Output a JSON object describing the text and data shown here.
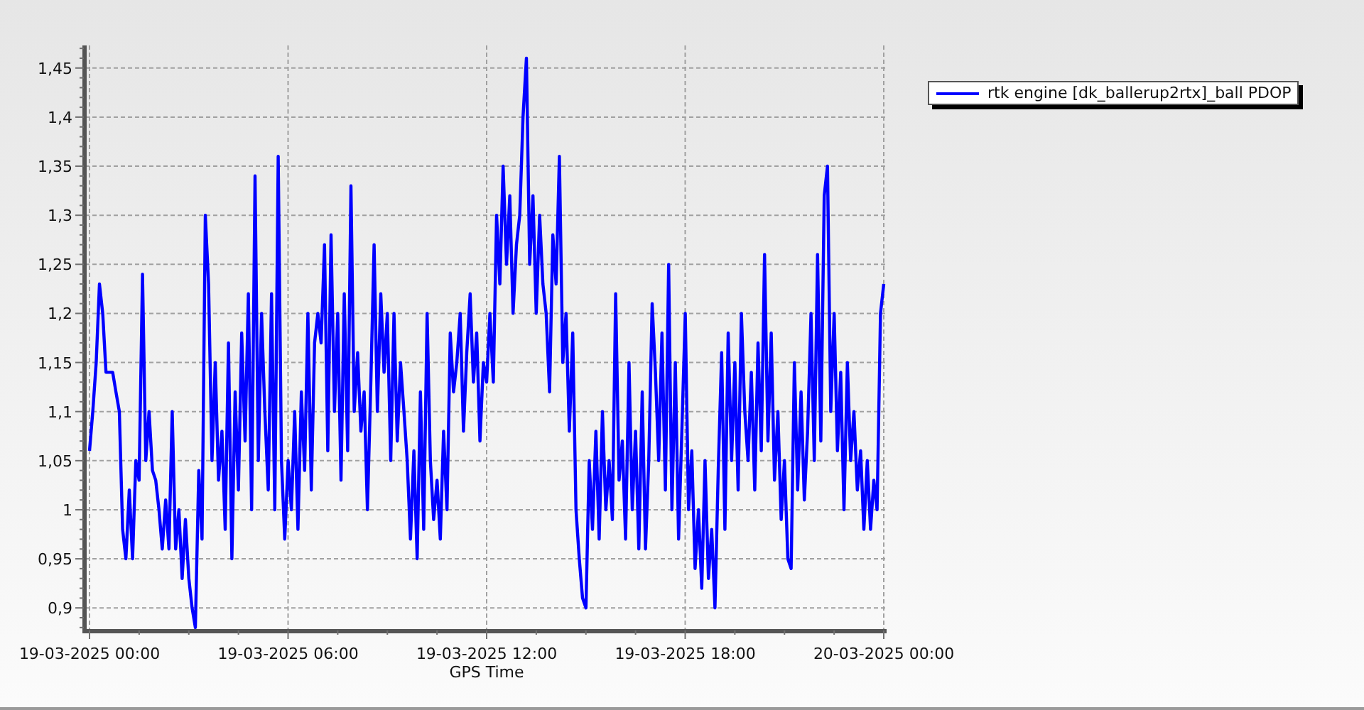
{
  "chart": {
    "chart_data": {
      "type": "line",
      "xlabel": "GPS Time",
      "grid": true,
      "categories": [
        "19-03-2025 00:00",
        null,
        null,
        null,
        null,
        null,
        null,
        null,
        null,
        null,
        null,
        null,
        null,
        null,
        null,
        null,
        null,
        null,
        null,
        null,
        null,
        null,
        null,
        null,
        null,
        null,
        null,
        null,
        null,
        null,
        null,
        null,
        null,
        null,
        null,
        null,
        null,
        null,
        null,
        null,
        null,
        null,
        null,
        null,
        null,
        null,
        null,
        null,
        null,
        null,
        null,
        null,
        null,
        null,
        null,
        null,
        null,
        null,
        null,
        null,
        "19-03-2025 06:00",
        null,
        null,
        null,
        null,
        null,
        null,
        null,
        null,
        null,
        null,
        null,
        null,
        null,
        null,
        null,
        null,
        null,
        null,
        null,
        null,
        null,
        null,
        null,
        null,
        null,
        null,
        null,
        null,
        null,
        null,
        null,
        null,
        null,
        null,
        null,
        null,
        null,
        null,
        null,
        null,
        null,
        null,
        null,
        null,
        null,
        null,
        null,
        null,
        null,
        null,
        null,
        null,
        null,
        null,
        null,
        null,
        null,
        null,
        null,
        "19-03-2025 12:00",
        null,
        null,
        null,
        null,
        null,
        null,
        null,
        null,
        null,
        null,
        null,
        null,
        null,
        null,
        null,
        null,
        null,
        null,
        null,
        null,
        null,
        null,
        null,
        null,
        null,
        null,
        null,
        null,
        null,
        null,
        null,
        null,
        null,
        null,
        null,
        null,
        null,
        null,
        null,
        null,
        null,
        null,
        null,
        null,
        null,
        null,
        null,
        null,
        null,
        null,
        null,
        null,
        null,
        null,
        null,
        null,
        null,
        null,
        null,
        "19-03-2025 18:00",
        null,
        null,
        null,
        null,
        null,
        null,
        null,
        null,
        null,
        null,
        null,
        null,
        null,
        null,
        null,
        null,
        null,
        null,
        null,
        null,
        null,
        null,
        null,
        null,
        null,
        null,
        null,
        null,
        null,
        null,
        null,
        null,
        null,
        null,
        null,
        null,
        null,
        null,
        null,
        null,
        null,
        null,
        null,
        null,
        null,
        null,
        null,
        null,
        null,
        null,
        null,
        null,
        null,
        null,
        null,
        null,
        null,
        null,
        null,
        "20-03-2025 00:00"
      ],
      "series": [
        {
          "name": "rtk engine [dk_ballerup2rtx]_ball PDOP",
          "color": "#0000ff",
          "values": [
            1.06,
            1.1,
            1.15,
            1.23,
            1.2,
            1.14,
            1.14,
            1.14,
            1.12,
            1.1,
            0.98,
            0.95,
            1.02,
            0.95,
            1.05,
            1.03,
            1.24,
            1.05,
            1.1,
            1.04,
            1.03,
            1.0,
            0.96,
            1.01,
            0.96,
            1.1,
            0.96,
            1.0,
            0.93,
            0.99,
            0.93,
            0.9,
            0.88,
            1.04,
            0.97,
            1.3,
            1.23,
            1.05,
            1.15,
            1.03,
            1.08,
            0.98,
            1.17,
            0.95,
            1.12,
            1.02,
            1.18,
            1.07,
            1.22,
            1.0,
            1.34,
            1.05,
            1.2,
            1.1,
            1.02,
            1.22,
            1.0,
            1.36,
            1.05,
            0.97,
            1.05,
            1.0,
            1.1,
            0.98,
            1.12,
            1.04,
            1.2,
            1.02,
            1.17,
            1.2,
            1.17,
            1.27,
            1.06,
            1.28,
            1.1,
            1.2,
            1.03,
            1.22,
            1.06,
            1.33,
            1.1,
            1.16,
            1.08,
            1.12,
            1.0,
            1.13,
            1.27,
            1.1,
            1.22,
            1.14,
            1.2,
            1.05,
            1.2,
            1.07,
            1.15,
            1.1,
            1.05,
            0.97,
            1.06,
            0.95,
            1.12,
            0.98,
            1.2,
            1.05,
            0.99,
            1.03,
            0.97,
            1.08,
            1.0,
            1.18,
            1.12,
            1.15,
            1.2,
            1.08,
            1.16,
            1.22,
            1.13,
            1.18,
            1.07,
            1.15,
            1.13,
            1.2,
            1.13,
            1.3,
            1.23,
            1.35,
            1.25,
            1.32,
            1.2,
            1.27,
            1.3,
            1.4,
            1.46,
            1.25,
            1.32,
            1.2,
            1.3,
            1.23,
            1.2,
            1.12,
            1.28,
            1.23,
            1.36,
            1.15,
            1.2,
            1.08,
            1.18,
            1.0,
            0.95,
            0.91,
            0.9,
            1.05,
            0.98,
            1.08,
            0.97,
            1.1,
            1.0,
            1.05,
            0.99,
            1.22,
            1.03,
            1.07,
            0.97,
            1.15,
            1.0,
            1.08,
            0.96,
            1.12,
            0.96,
            1.05,
            1.21,
            1.14,
            1.05,
            1.18,
            1.02,
            1.25,
            1.0,
            1.15,
            0.97,
            1.08,
            1.2,
            1.0,
            1.06,
            0.94,
            1.0,
            0.92,
            1.05,
            0.93,
            0.98,
            0.9,
            1.04,
            1.16,
            0.98,
            1.18,
            1.05,
            1.15,
            1.02,
            1.2,
            1.1,
            1.05,
            1.14,
            1.02,
            1.17,
            1.06,
            1.26,
            1.07,
            1.18,
            1.03,
            1.1,
            0.99,
            1.05,
            0.95,
            0.94,
            1.15,
            1.02,
            1.12,
            1.01,
            1.08,
            1.2,
            1.05,
            1.26,
            1.07,
            1.32,
            1.35,
            1.1,
            1.2,
            1.06,
            1.14,
            1.0,
            1.15,
            1.05,
            1.1,
            1.02,
            1.06,
            0.98,
            1.05,
            0.98,
            1.03,
            1.0,
            1.2,
            1.23
          ]
        }
      ],
      "ylim": [
        0.877,
        1.473
      ],
      "yticks": [
        {
          "value": 0.9,
          "label": "0,9"
        },
        {
          "value": 0.95,
          "label": "0,95"
        },
        {
          "value": 1,
          "label": "1"
        },
        {
          "value": 1.05,
          "label": "1,05"
        },
        {
          "value": 1.1,
          "label": "1,1"
        },
        {
          "value": 1.15,
          "label": "1,15"
        },
        {
          "value": 1.2,
          "label": "1,2"
        },
        {
          "value": 1.25,
          "label": "1,25"
        },
        {
          "value": 1.3,
          "label": "1,3"
        },
        {
          "value": 1.35,
          "label": "1,35"
        },
        {
          "value": 1.4,
          "label": "1,4"
        },
        {
          "value": 1.45,
          "label": "1,45"
        }
      ]
    }
  }
}
